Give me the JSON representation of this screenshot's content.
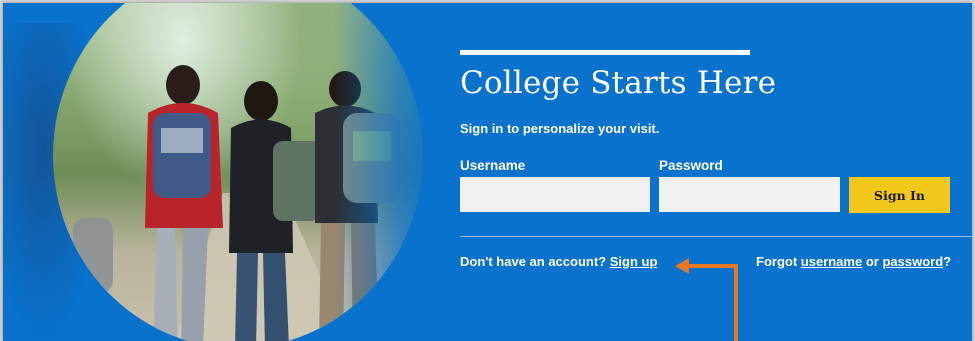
{
  "hero": {
    "title": "College Starts Here",
    "subtitle": "Sign in to personalize your visit."
  },
  "form": {
    "username_label": "Username",
    "password_label": "Password",
    "username_value": "",
    "password_value": "",
    "signin_label": "Sign In"
  },
  "footer": {
    "no_account_text": "Don't have an account?",
    "signup_link": "Sign up",
    "forgot_prefix": "Forgot",
    "username_link": "username",
    "or_text": "or",
    "password_link": "password",
    "question_mark": "?"
  },
  "colors": {
    "background": "#0872cd",
    "button": "#f4c81a",
    "annotation_arrow": "#e87722"
  }
}
